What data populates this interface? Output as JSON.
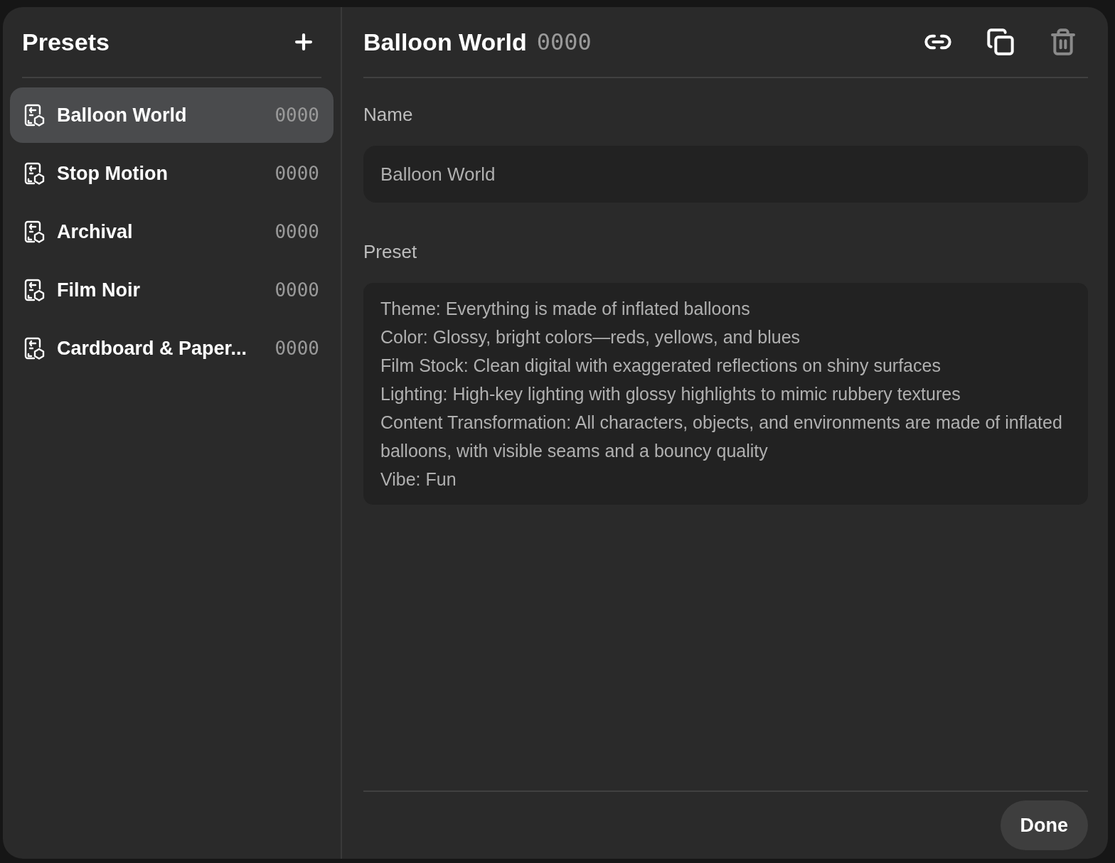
{
  "sidebar": {
    "title": "Presets",
    "items": [
      {
        "name": "Balloon World",
        "count": "0000",
        "selected": true
      },
      {
        "name": "Stop Motion",
        "count": "0000",
        "selected": false
      },
      {
        "name": "Archival",
        "count": "0000",
        "selected": false
      },
      {
        "name": "Film Noir",
        "count": "0000",
        "selected": false
      },
      {
        "name": "Cardboard & Paper...",
        "count": "0000",
        "selected": false
      }
    ]
  },
  "detail": {
    "title": "Balloon World",
    "count": "0000",
    "actions": [
      {
        "kind": "link",
        "disabled": false
      },
      {
        "kind": "duplicate",
        "disabled": false
      },
      {
        "kind": "delete",
        "disabled": true
      }
    ],
    "name_label": "Name",
    "name_value": "Balloon World",
    "preset_label": "Preset",
    "preset_value": "Theme: Everything is made of inflated balloons\nColor: Glossy, bright colors—reds, yellows, and blues\nFilm Stock: Clean digital with exaggerated reflections on shiny surfaces\nLighting: High-key lighting with glossy highlights to mimic rubbery textures\nContent Transformation: All characters, objects, and environments are made of inflated balloons, with visible seams and a bouncy quality\nVibe: Fun",
    "done": "Done"
  }
}
